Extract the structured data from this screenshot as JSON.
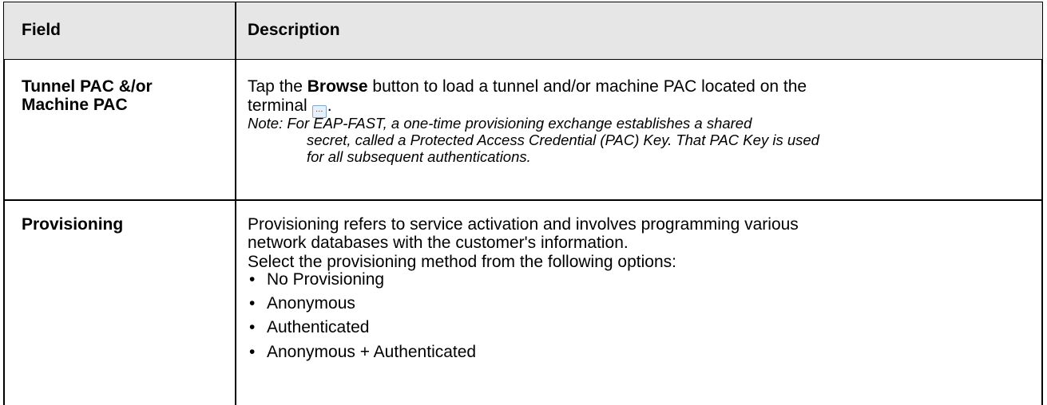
{
  "table": {
    "headers": {
      "field": "Field",
      "description": "Description"
    },
    "rows": [
      {
        "field_line1": "Tunnel PAC &/or",
        "field_line2": "Machine PAC",
        "desc_line1_pre": "Tap the ",
        "desc_line1_bold": "Browse",
        "desc_line1_post": " button to load a tunnel and/or machine PAC located on the",
        "desc_line2": "terminal",
        "desc_line2_icon": "browse-button-icon",
        "desc_line2_end": ".",
        "note_line1": "Note: For EAP-FAST, a one-time provisioning exchange establishes a shared",
        "note_line2": "secret, called a Protected Access Credential (PAC) Key. That PAC Key is used",
        "note_line3": "for all subsequent authentications."
      },
      {
        "field_line1": "Provisioning",
        "desc_line1": "Provisioning refers to service activation and involves programming various",
        "desc_line2": "network databases with the customer's information.",
        "desc_line3": "Select the provisioning method from the following options:",
        "bullet_glyph": "•",
        "options": [
          "No Provisioning",
          "Anonymous",
          "Authenticated",
          "Anonymous + Authenticated"
        ]
      }
    ]
  }
}
